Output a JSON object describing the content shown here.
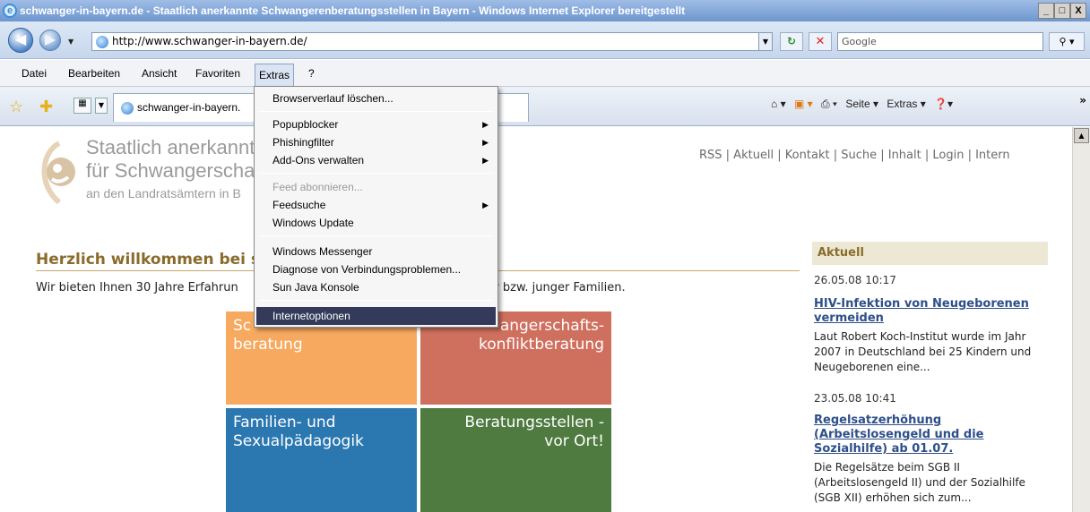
{
  "window": {
    "title": "schwanger-in-bayern.de - Staatlich anerkannte Schwangerenberatungsstellen in Bayern - Windows Internet Explorer bereitgestellt",
    "controls": [
      "_",
      "□",
      "X"
    ]
  },
  "addressbar": {
    "url": "http://www.schwanger-in-bayern.de/",
    "search_placeholder": "Google"
  },
  "menubar": {
    "items": [
      "Datei",
      "Bearbeiten",
      "Ansicht",
      "Favoriten",
      "Extras",
      "?"
    ]
  },
  "tabbar": {
    "tab_title": "schwanger-in-bayern.",
    "commands": [
      "Seite ▾",
      "Extras ▾"
    ]
  },
  "extras_menu": {
    "items": [
      {
        "label": "Browserverlauf löschen...",
        "submenu": false,
        "disabled": false
      },
      {
        "label": "Popupblocker",
        "submenu": true,
        "disabled": false
      },
      {
        "label": "Phishingfilter",
        "submenu": true,
        "disabled": false
      },
      {
        "label": "Add-Ons verwalten",
        "submenu": true,
        "disabled": false
      },
      {
        "label": "Feed abonnieren...",
        "submenu": false,
        "disabled": true
      },
      {
        "label": "Feedsuche",
        "submenu": true,
        "disabled": false
      },
      {
        "label": "Windows Update",
        "submenu": false,
        "disabled": false
      },
      {
        "label": "Windows Messenger",
        "submenu": false,
        "disabled": false
      },
      {
        "label": "Diagnose von Verbindungsproblemen...",
        "submenu": false,
        "disabled": false
      },
      {
        "label": "Sun Java Konsole",
        "submenu": false,
        "disabled": false
      },
      {
        "label": "Internetoptionen",
        "submenu": false,
        "disabled": false,
        "highlighted": true
      }
    ]
  },
  "page": {
    "logo": {
      "line1": "Staatlich anerkannte",
      "line2": "für Schwangerscha",
      "line3": "an den Landratsämtern in B"
    },
    "topnav": "RSS | Aktuell | Kontakt | Suche | Inhalt | Login | Intern",
    "welcome_title": "Herzlich willkommen bei s",
    "welcome_text_left": "Wir bieten Ihnen 30 Jahre Erfahrun",
    "welcome_text_right": "hwangerer bzw. junger Familien.",
    "tiles": [
      {
        "line1": "Sc",
        "line2": "beratung"
      },
      {
        "line1": "angerschafts-",
        "line2": "konfliktberatung"
      },
      {
        "line1": "Familien- und",
        "line2": "Sexualpädagogik"
      },
      {
        "line1": "Beratungsstellen -",
        "line2": "vor Ort!"
      }
    ],
    "sidebar": {
      "heading": "Aktuell",
      "news": [
        {
          "date": "26.05.08 10:17",
          "title": "HIV-Infektion von Neugeborenen vermeiden",
          "text": "Laut Robert Koch-Institut wurde im Jahr 2007 in Deutschland bei 25 Kindern und Neugeborenen eine..."
        },
        {
          "date": "23.05.08 10:41",
          "title": "Regelsatzerhöhung (Arbeitslosengeld und die Sozialhilfe) ab 01.07.",
          "text": "Die Regelsätze beim SGB II (Arbeitslosengeld II) und der Sozialhilfe (SGB XII) erhöhen sich zum..."
        }
      ]
    }
  },
  "colors": {
    "tile_orange": "#f6a95f",
    "tile_red": "#cf6f5e",
    "tile_blue": "#2b78b1",
    "tile_green": "#4f7a40",
    "heading_brown": "#8a6b2b",
    "link_blue": "#2e4f8a",
    "menu_highlight": "#333a5a"
  }
}
